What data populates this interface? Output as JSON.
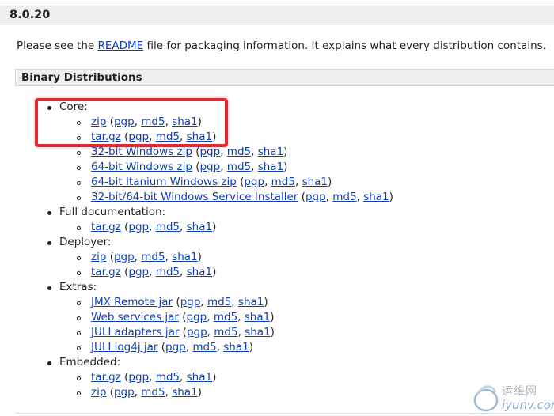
{
  "version": "8.0.20",
  "intro": {
    "before": "Please see the ",
    "link": "README",
    "after": " file for packaging information. It explains what every distribution contains."
  },
  "section_title": "Binary Distributions",
  "distributions": [
    {
      "label": "Core:",
      "items": [
        {
          "name": "zip",
          "sigs": [
            "pgp",
            "md5",
            "sha1"
          ]
        },
        {
          "name": "tar.gz",
          "sigs": [
            "pgp",
            "md5",
            "sha1"
          ]
        },
        {
          "name": "32-bit Windows zip",
          "sigs": [
            "pgp",
            "md5",
            "sha1"
          ]
        },
        {
          "name": "64-bit Windows zip",
          "sigs": [
            "pgp",
            "md5",
            "sha1"
          ]
        },
        {
          "name": "64-bit Itanium Windows zip",
          "sigs": [
            "pgp",
            "md5",
            "sha1"
          ]
        },
        {
          "name": "32-bit/64-bit Windows Service Installer",
          "sigs": [
            "pgp",
            "md5",
            "sha1"
          ]
        }
      ]
    },
    {
      "label": "Full documentation:",
      "items": [
        {
          "name": "tar.gz",
          "sigs": [
            "pgp",
            "md5",
            "sha1"
          ]
        }
      ]
    },
    {
      "label": "Deployer:",
      "items": [
        {
          "name": "zip",
          "sigs": [
            "pgp",
            "md5",
            "sha1"
          ]
        },
        {
          "name": "tar.gz",
          "sigs": [
            "pgp",
            "md5",
            "sha1"
          ]
        }
      ]
    },
    {
      "label": "Extras:",
      "items": [
        {
          "name": "JMX Remote jar",
          "sigs": [
            "pgp",
            "md5",
            "sha1"
          ]
        },
        {
          "name": "Web services jar",
          "sigs": [
            "pgp",
            "md5",
            "sha1"
          ]
        },
        {
          "name": "JULI adapters jar",
          "sigs": [
            "pgp",
            "md5",
            "sha1"
          ]
        },
        {
          "name": "JULI log4j jar",
          "sigs": [
            "pgp",
            "md5",
            "sha1"
          ]
        }
      ]
    },
    {
      "label": "Embedded:",
      "items": [
        {
          "name": "tar.gz",
          "sigs": [
            "pgp",
            "md5",
            "sha1"
          ]
        },
        {
          "name": "zip",
          "sigs": [
            "pgp",
            "md5",
            "sha1"
          ]
        }
      ]
    }
  ],
  "watermark": {
    "cn": "运维网",
    "en": "iyunv.com"
  },
  "colors": {
    "link": "#0f3fb0",
    "highlight": "#e02a35",
    "bar_bg": "#efefef"
  }
}
